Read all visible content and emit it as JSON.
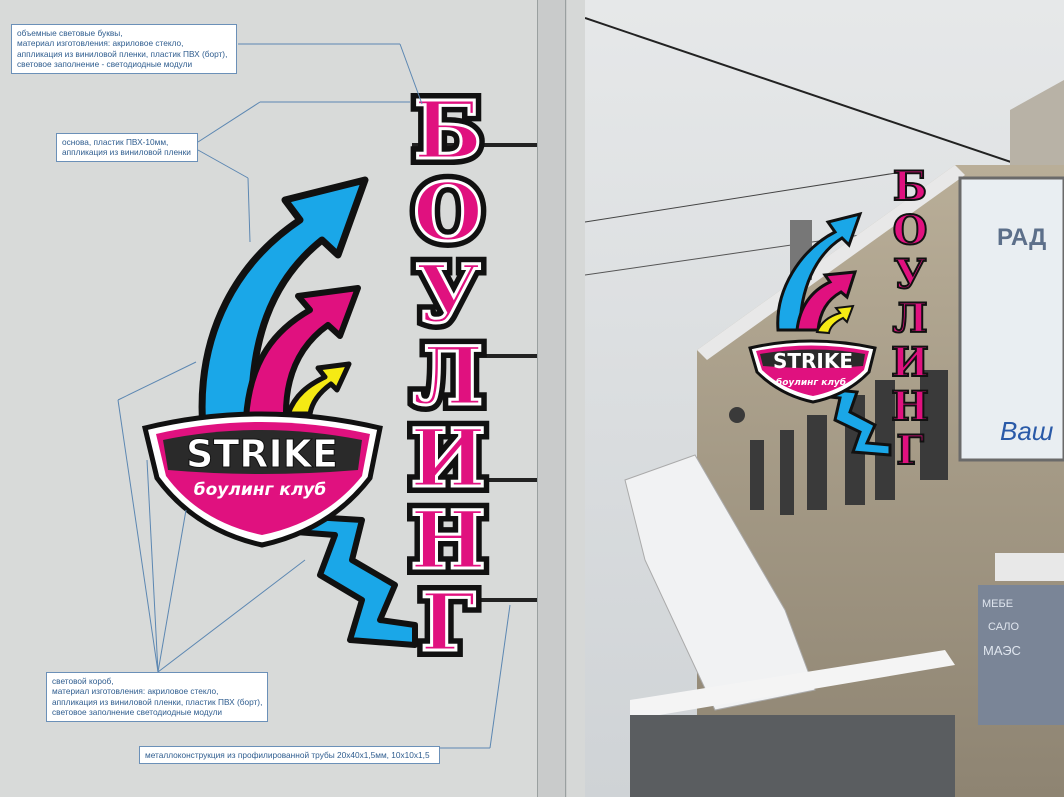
{
  "annotations": {
    "letters": [
      "объемные световые буквы,",
      "материал изготовления: акриловое стекло,",
      "аппликация из виниловой пленки, пластик ПВХ (борт),",
      "световое заполнение - светодиодные модули"
    ],
    "base": [
      "основа, пластик ПВХ-10мм,",
      "аппликация из виниловой пленки"
    ],
    "lightbox": [
      "световой короб,",
      "материал изготовления: акриловое стекло,",
      "аппликация из виниловой пленки, пластик ПВХ (борт),",
      "световое заполнение светодиодные модули"
    ],
    "frame": [
      "металлоконструкция из профилированной трубы 20х40х1,5мм, 10х10х1,5"
    ]
  },
  "sign": {
    "vertical_text": [
      "Б",
      "О",
      "У",
      "Л",
      "И",
      "Н",
      "Г"
    ],
    "logo_title": "STRIKE",
    "logo_subtitle": "боулинг клуб"
  },
  "photo": {
    "billboard_text_1": "РАД",
    "billboard_text_2": "Ваш",
    "shop_text_1": "МЕБЕ",
    "shop_text_2": "САЛО",
    "shop_text_3": "МАЭС"
  },
  "colors": {
    "magenta": "#e0117f",
    "blue": "#1aa7e8",
    "yellow": "#f5ea14",
    "outline": "#1a1a1a",
    "bracket": "#2a2a2a"
  }
}
